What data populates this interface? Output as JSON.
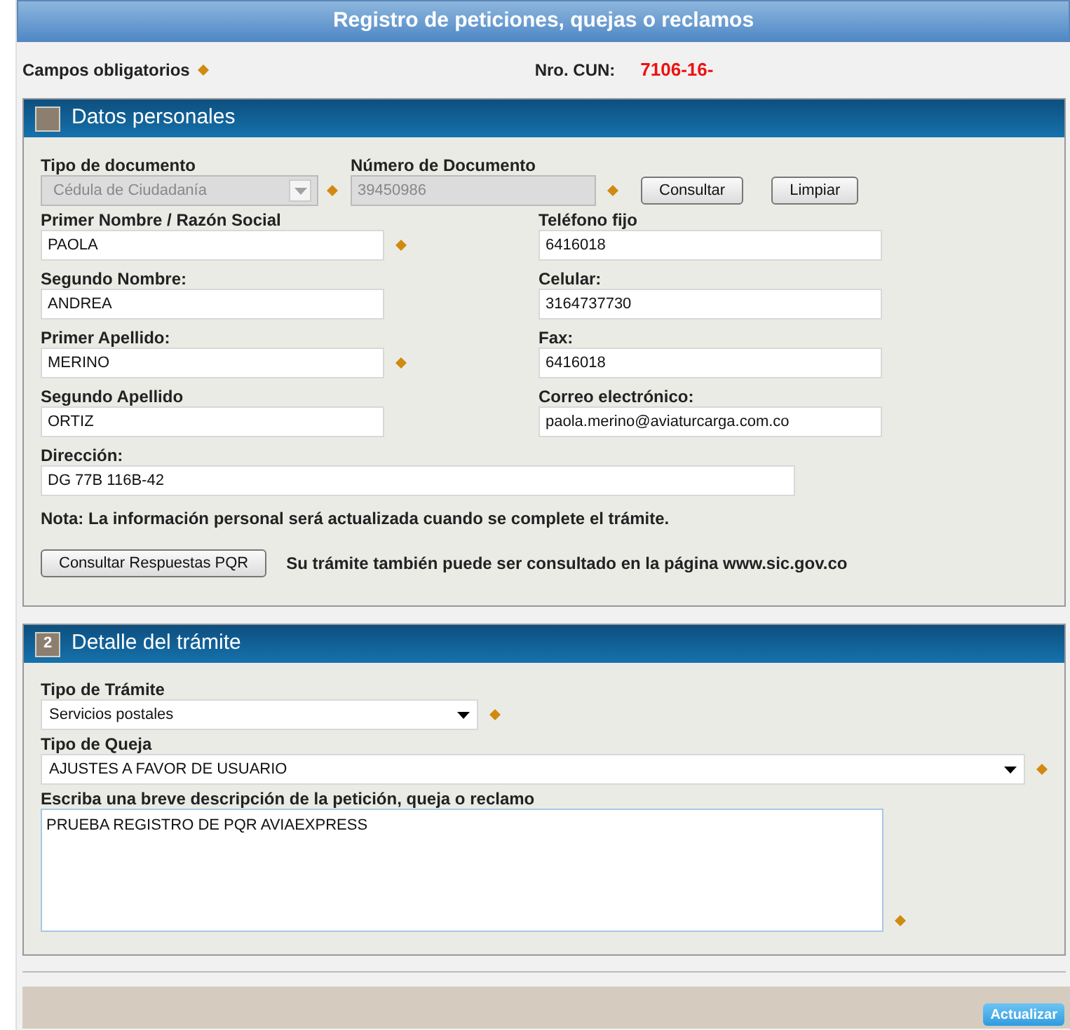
{
  "header": {
    "title": "Registro de peticiones, quejas o reclamos"
  },
  "required_legend": {
    "label": "Campos obligatorios"
  },
  "cun": {
    "label": "Nro. CUN:",
    "value": "7106-16-"
  },
  "personal": {
    "title": "Datos personales",
    "document_type": {
      "label": "Tipo de documento",
      "value": "Cédula de Ciudadanía",
      "disabled": true,
      "required": true
    },
    "document_number": {
      "label": "Número de Documento",
      "value": "39450986",
      "disabled": true,
      "required": true
    },
    "buttons": [
      "Consultar",
      "Limpiar"
    ],
    "fields": [
      {
        "label": "Primer Nombre / Razón Social",
        "value": "PAOLA",
        "required": true
      },
      {
        "label": "Teléfono fijo",
        "value": "6416018",
        "required": false
      },
      {
        "label": "Segundo Nombre:",
        "value": "ANDREA",
        "required": false
      },
      {
        "label": "Celular:",
        "value": "3164737730",
        "required": false
      },
      {
        "label": "Primer Apellido:",
        "value": "MERINO",
        "required": true
      },
      {
        "label": "Fax:",
        "value": "6416018",
        "required": false
      },
      {
        "label": "Segundo Apellido",
        "value": "ORTIZ",
        "required": false
      },
      {
        "label": "Correo electrónico:",
        "value": "paola.merino@aviaturcarga.com.co",
        "required": false
      }
    ],
    "address": {
      "label": "Dirección:",
      "value": "DG 77B 116B-42"
    },
    "note": "Nota: La información personal será actualizada cuando se complete el trámite.",
    "query_button": "Consultar Respuestas PQR",
    "info": "Su trámite también puede ser consultado en la página www.sic.gov.co"
  },
  "detail": {
    "number": "2",
    "title": "Detalle del trámite",
    "fields": [
      {
        "kind": "short-select",
        "label": "Tipo de Trámite",
        "value": "Servicios postales",
        "required": true
      },
      {
        "kind": "long-select",
        "label": "Tipo de Queja",
        "value": "AJUSTES A FAVOR DE USUARIO",
        "required": true
      },
      {
        "kind": "textarea",
        "label": "Escriba una breve descripción de la petición, queja o reclamo",
        "value": "PRUEBA REGISTRO DE PQR AVIAEXPRESS",
        "required": true
      }
    ]
  },
  "footer": {
    "button": "Actualizar"
  }
}
